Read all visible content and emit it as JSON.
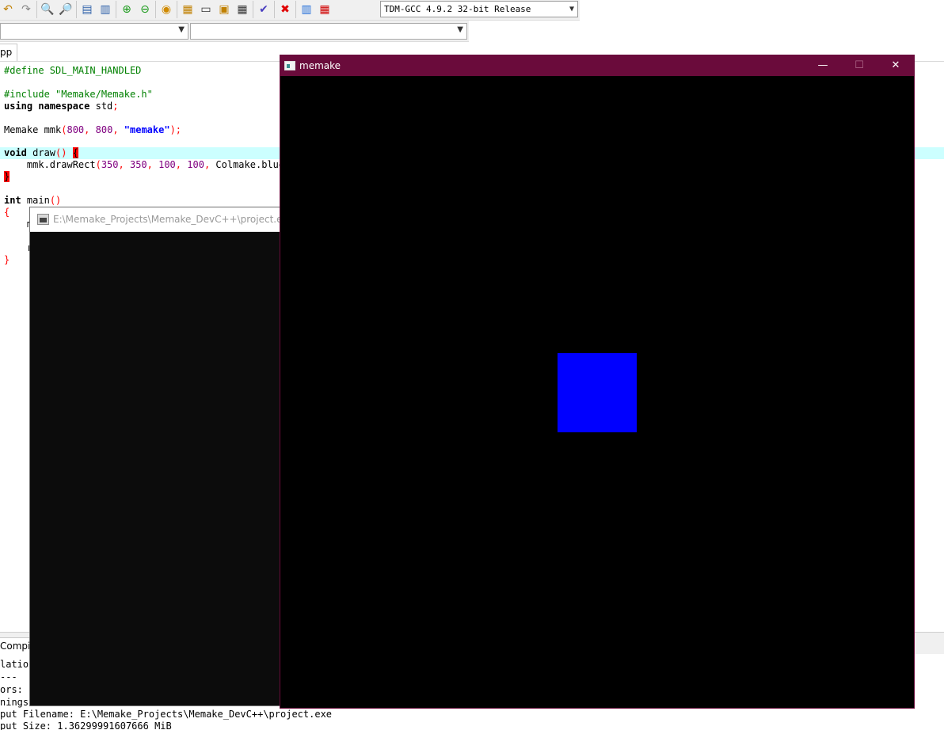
{
  "toolbar": {
    "compiler": "TDM-GCC 4.9.2 32-bit Release"
  },
  "editor": {
    "tab_label": "pp",
    "lines": {
      "l1": "#define SDL_MAIN_HANDLED",
      "l2": "#include \"Memake/Memake.h\"",
      "l3_kw": "using namespace",
      "l3_rest": " std",
      "l4_a": "Memake mmk",
      "l4_n1": "800",
      "l4_n2": "800",
      "l4_str": "\"memake\"",
      "l5_kw": "void",
      "l5_rest": " draw",
      "l6_a": "    mmk.drawRect",
      "l6_n1": "350",
      "l6_n2": "350",
      "l6_n3": "100",
      "l6_n4": "100",
      "l6_b": " Colmake.blue",
      "l8_kw": "int",
      "l8_rest": " main",
      "l10_frag": "m",
      "l12_frag": "r"
    }
  },
  "log": {
    "tab_label": "Compile",
    "lines": [
      "latio",
      "---",
      "ors:",
      "nings",
      "put Filename: E:\\Memake_Projects\\Memake_DevC++\\project.exe",
      "put Size: 1.36299991607666 MiB"
    ]
  },
  "console": {
    "title": "E:\\Memake_Projects\\Memake_DevC++\\project.exe"
  },
  "sdl_window": {
    "title": "memake",
    "minimize": "—",
    "maximize": "☐",
    "close": "✕",
    "rect_color": "#0000ff"
  }
}
